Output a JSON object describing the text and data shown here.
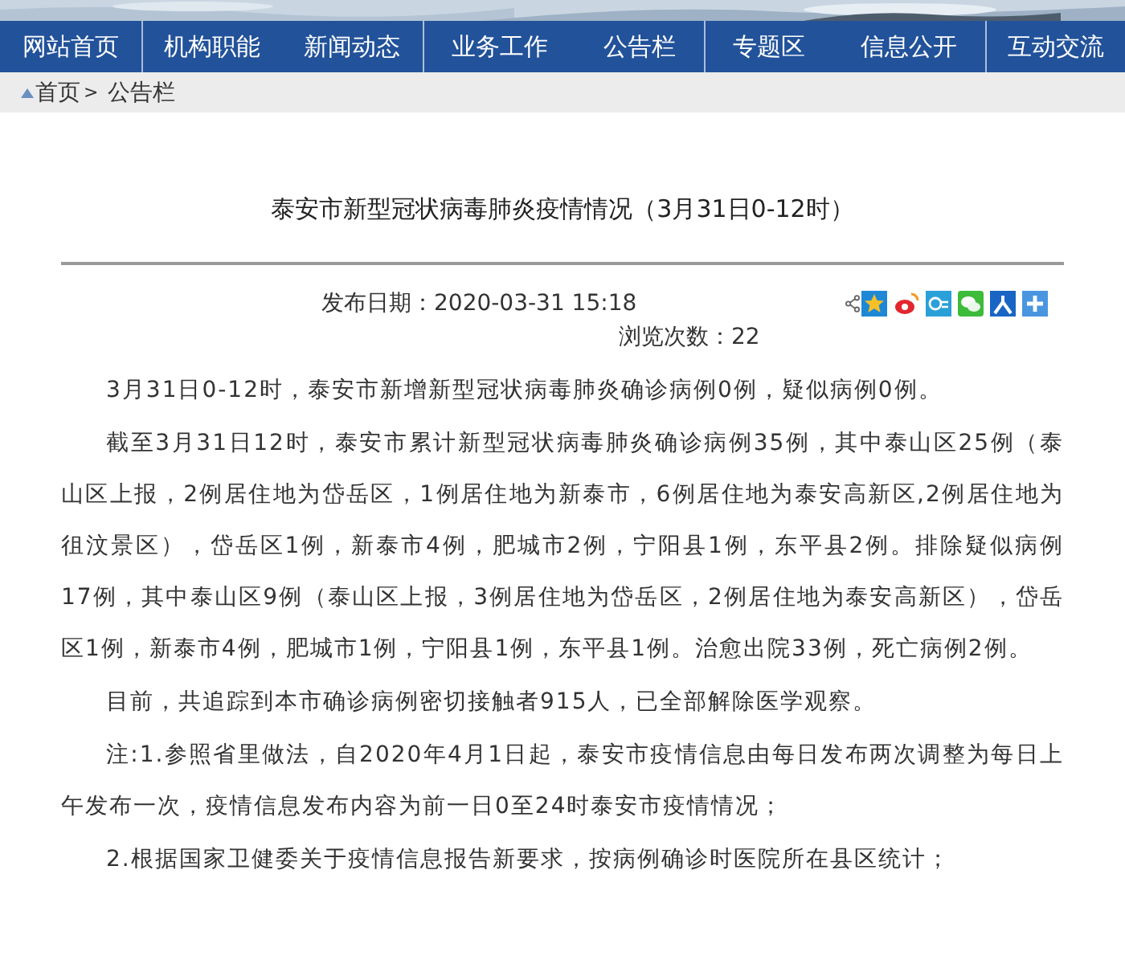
{
  "nav": {
    "groups": [
      [
        {
          "label": "网站首页",
          "selected": false
        }
      ],
      [
        {
          "label": "机构职能",
          "selected": false
        },
        {
          "label": "新闻动态",
          "selected": false
        }
      ],
      [
        {
          "label": "业务工作",
          "selected": false
        },
        {
          "label": "公告栏",
          "selected": false
        }
      ],
      [
        {
          "label": "专题区",
          "selected": false
        },
        {
          "label": "信息公开",
          "selected": false
        }
      ],
      [
        {
          "label": "互动交流",
          "selected": false
        }
      ]
    ]
  },
  "breadcrumb": {
    "home": "首页",
    "separator": ">",
    "current": "公告栏"
  },
  "article": {
    "title": "泰安市新型冠状病毒肺炎疫情情况（3月31日0-12时）",
    "published": "发布日期：2020-03-31 15:18",
    "views": "浏览次数：22",
    "paragraphs": [
      {
        "text": "3月31日0-12时，泰安市新增新型冠状病毒肺炎确诊病例0例，疑似病例0例。"
      },
      {
        "text": "截至3月31日12时，泰安市累计新型冠状病毒肺炎确诊病例35例，其中泰山区25例（泰山区上报，2例居住地为岱岳区，1例居住地为新泰市，6例居住地为泰安高新区,2例居住地为徂汶景区），岱岳区1例，新泰市4例，肥城市2例，宁阳县1例，东平县2例。排除疑似病例17例，其中泰山区9例（泰山区上报，3例居住地为岱岳区，2例居住地为泰安高新区），岱岳区1例，新泰市4例，肥城市1例，宁阳县1例，东平县1例。治愈出院33例，死亡病例2例。"
      },
      {
        "text": "目前，共追踪到本市确诊病例密切接触者915人，已全部解除医学观察。"
      },
      {
        "text": "注:1.参照省里做法，自2020年4月1日起，泰安市疫情信息由每日发布两次调整为每日上午发布一次，疫情信息发布内容为前一日0至24时泰安市疫情情况；"
      },
      {
        "text": "2.根据国家卫健委关于疫情信息报告新要求，按病例确诊时医院所在县区统计；"
      }
    ]
  }
}
